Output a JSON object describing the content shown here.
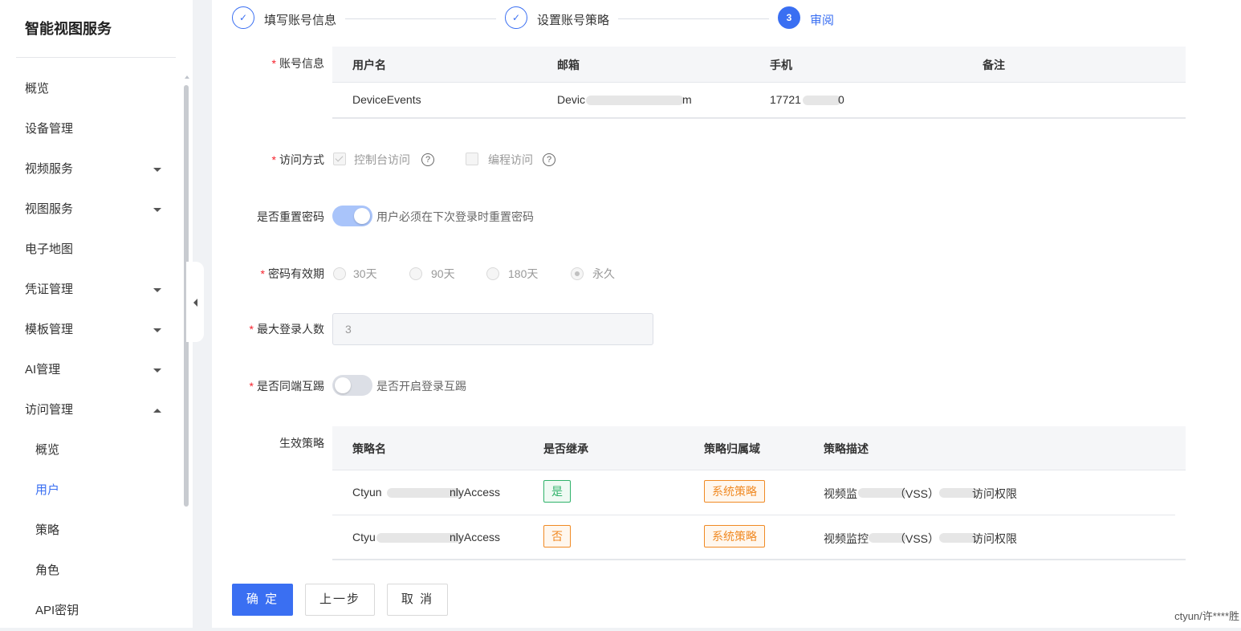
{
  "app": {
    "title": "智能视图服务"
  },
  "sidebar": {
    "items": [
      {
        "label": "概览"
      },
      {
        "label": "设备管理"
      },
      {
        "label": "视频服务"
      },
      {
        "label": "视图服务"
      },
      {
        "label": "电子地图"
      },
      {
        "label": "凭证管理"
      },
      {
        "label": "模板管理"
      },
      {
        "label": "AI管理"
      },
      {
        "label": "访问管理",
        "expanded": true
      },
      {
        "label": "概览",
        "sub": true
      },
      {
        "label": "用户",
        "sub": true,
        "active": true
      },
      {
        "label": "策略",
        "sub": true
      },
      {
        "label": "角色",
        "sub": true
      },
      {
        "label": "API密钥",
        "sub": true
      }
    ]
  },
  "steps": [
    {
      "label": "填写账号信息",
      "status": "done",
      "icon": "check-icon"
    },
    {
      "label": "设置账号策略",
      "status": "done",
      "icon": "check-icon"
    },
    {
      "number": "3",
      "label": "审阅",
      "status": "active"
    }
  ],
  "account": {
    "label": "账号信息",
    "headers": [
      "用户名",
      "邮箱",
      "手机",
      "备注"
    ],
    "row": {
      "username": "DeviceEvents",
      "email_start": "Devic",
      "email_end": "m",
      "phone_start": "17721",
      "phone_end": "0",
      "remark": ""
    }
  },
  "access": {
    "label": "访问方式",
    "options": [
      {
        "label": "控制台访问",
        "checked": true
      },
      {
        "label": "编程访问",
        "checked": false
      }
    ],
    "help_icon": "question-circle-icon",
    "help_glyph": "?"
  },
  "reset_password": {
    "label": "是否重置密码",
    "enabled": true,
    "description": "用户必须在下次登录时重置密码"
  },
  "password_validity": {
    "label": "密码有效期",
    "options": [
      "30天",
      "90天",
      "180天",
      "永久"
    ],
    "selected": "永久"
  },
  "max_login": {
    "label": "最大登录人数",
    "value": "3"
  },
  "kick_out": {
    "label": "是否同端互踢",
    "enabled": false,
    "description": "是否开启登录互踢"
  },
  "policies": {
    "label": "生效策略",
    "headers": [
      "策略名",
      "是否继承",
      "策略归属域",
      "策略描述"
    ],
    "rows": [
      {
        "name_start": "Ctyun",
        "name_end": "nlyAccess",
        "inherit": "是",
        "domain": "系统策略",
        "desc_start": "视频监",
        "desc_mid": "（VSS）",
        "desc_end": "访问权限"
      },
      {
        "name_start": "Ctyu",
        "name_end": "nlyAccess",
        "inherit": "否",
        "domain": "系统策略",
        "desc_start": "视频监控",
        "desc_mid": "（VSS）",
        "desc_end": "访问权限"
      }
    ]
  },
  "buttons": {
    "confirm": "确 定",
    "prev": "上一步",
    "cancel": "取 消"
  },
  "footer": {
    "watermark": "ctyun/许****胜"
  },
  "colors": {
    "primary": "#3a6ff2",
    "required": "#f5222d",
    "inherit_yes": "#2fb26a",
    "system_policy": "#f08a24"
  }
}
